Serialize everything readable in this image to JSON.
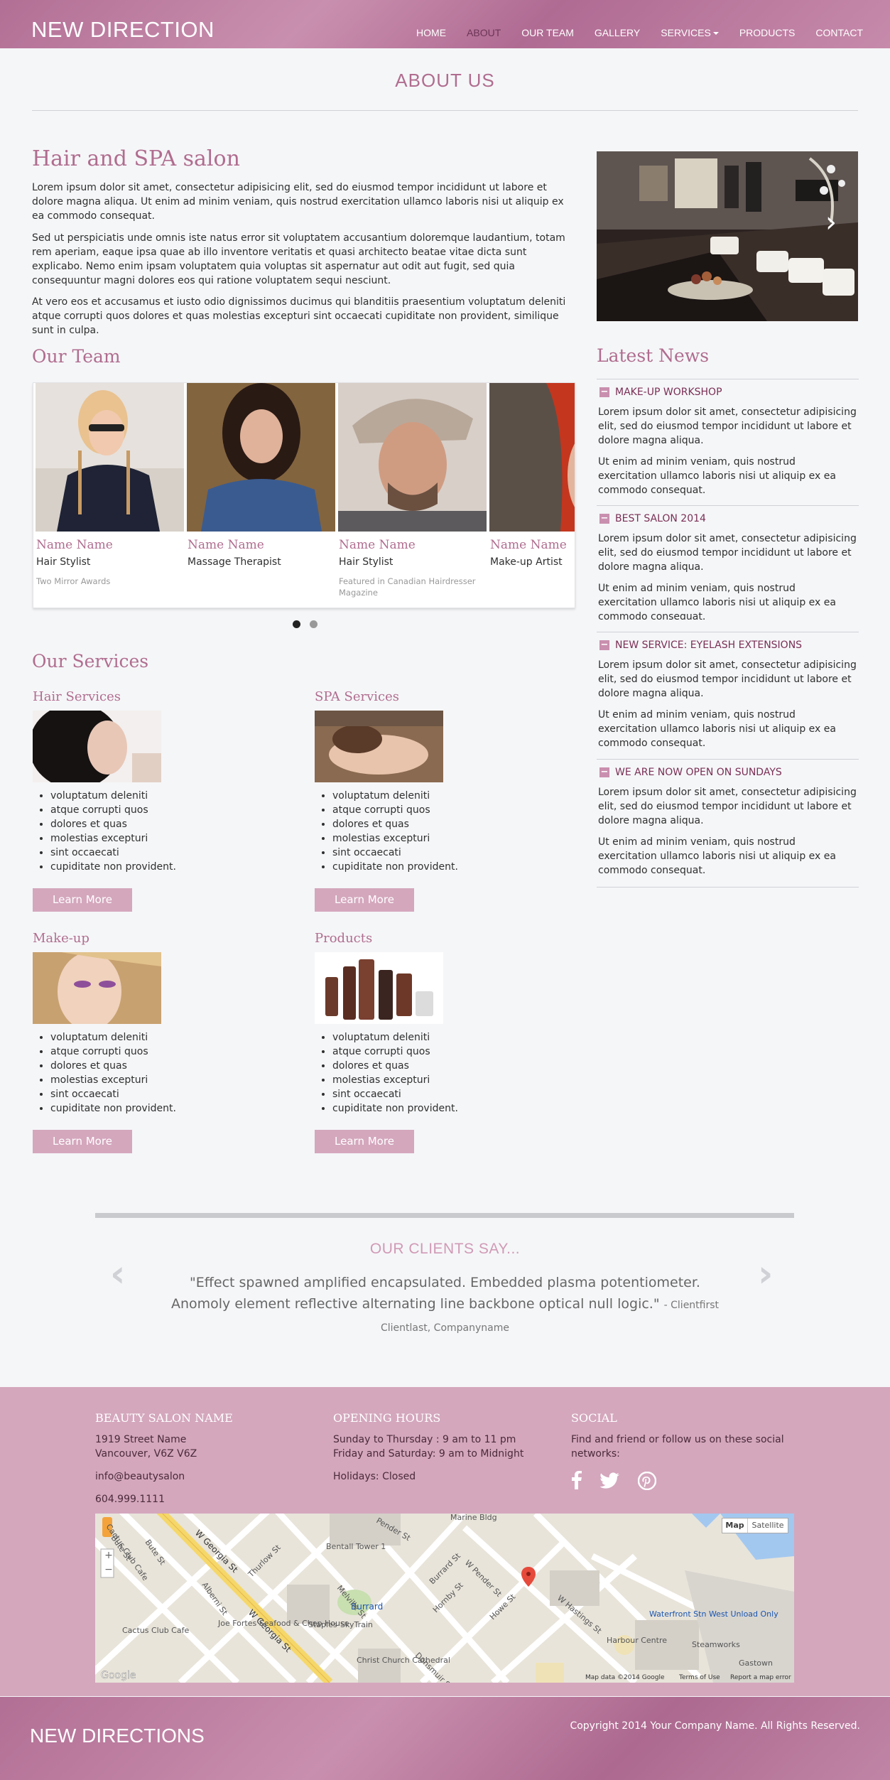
{
  "header": {
    "logo": "NEW DIRECTION",
    "nav": [
      "HOME",
      "ABOUT",
      "OUR TEAM",
      "GALLERY",
      "SERVICES",
      "PRODUCTS",
      "CONTACT"
    ],
    "active": "ABOUT"
  },
  "page_title": "ABOUT US",
  "about": {
    "heading": "Hair and SPA salon",
    "paragraphs": [
      "Lorem ipsum dolor sit amet, consectetur adipisicing elit, sed do eiusmod tempor incididunt ut labore et dolore magna aliqua. Ut enim ad minim veniam, quis nostrud exercitation ullamco laboris nisi ut aliquip ex ea commodo consequat.",
      "Sed ut perspiciatis unde omnis iste natus error sit voluptatem accusantium doloremque laudantium, totam rem aperiam, eaque ipsa quae ab illo inventore veritatis et quasi architecto beatae vitae dicta sunt explicabo. Nemo enim ipsam voluptatem quia voluptas sit aspernatur aut odit aut fugit, sed quia consequuntur magni dolores eos qui ratione voluptatem sequi nesciunt.",
      "At vero eos et accusamus et iusto odio dignissimos ducimus qui blanditiis praesentium voluptatum deleniti atque corrupti quos dolores et quas molestias excepturi sint occaecati cupiditate non provident, similique sunt in culpa."
    ]
  },
  "team": {
    "heading": "Our Team",
    "members": [
      {
        "name": "Name Name",
        "role": "Hair Stylist",
        "award": "Two Mirror Awards"
      },
      {
        "name": "Name Name",
        "role": "Massage Therapist",
        "award": ""
      },
      {
        "name": "Name Name",
        "role": "Hair Stylist",
        "award": "Featured in Canadian Hairdresser Magazine"
      },
      {
        "name": "Name Name",
        "role": "Make-up Artist",
        "award": ""
      }
    ]
  },
  "news": {
    "heading": "Latest News",
    "items": [
      {
        "title": "MAKE-UP WORKSHOP",
        "p1": "Lorem ipsum dolor sit amet, consectetur adipisicing elit, sed do eiusmod tempor incididunt ut labore et dolore magna aliqua.",
        "p2": "Ut enim ad minim veniam, quis nostrud exercitation ullamco laboris nisi ut aliquip ex ea commodo consequat."
      },
      {
        "title": "BEST SALON 2014",
        "p1": "Lorem ipsum dolor sit amet, consectetur adipisicing elit, sed do eiusmod tempor incididunt ut labore et dolore magna aliqua.",
        "p2": "Ut enim ad minim veniam, quis nostrud exercitation ullamco laboris nisi ut aliquip ex ea commodo consequat."
      },
      {
        "title": "NEW SERVICE: EYELASH EXTENSIONS",
        "p1": "Lorem ipsum dolor sit amet, consectetur adipisicing elit, sed do eiusmod tempor incididunt ut labore et dolore magna aliqua.",
        "p2": "Ut enim ad minim veniam, quis nostrud exercitation ullamco laboris nisi ut aliquip ex ea commodo consequat."
      },
      {
        "title": "WE ARE NOW OPEN ON SUNDAYS",
        "p1": "Lorem ipsum dolor sit amet, consectetur adipisicing elit, sed do eiusmod tempor incididunt ut labore et dolore magna aliqua.",
        "p2": "Ut enim ad minim veniam, quis nostrud exercitation ullamco laboris nisi ut aliquip ex ea commodo consequat."
      }
    ]
  },
  "services": {
    "heading": "Our Services",
    "items": [
      {
        "title": "Hair Services",
        "bullets": [
          "voluptatum deleniti",
          "atque corrupti quos",
          "dolores et quas",
          "molestias excepturi",
          "sint occaecati",
          "cupiditate non provident."
        ],
        "button": "Learn More"
      },
      {
        "title": "SPA Services",
        "bullets": [
          "voluptatum deleniti",
          "atque corrupti quos",
          "dolores et quas",
          "molestias excepturi",
          "sint occaecati",
          "cupiditate non provident."
        ],
        "button": "Learn More"
      },
      {
        "title": "Make-up",
        "bullets": [
          "voluptatum deleniti",
          "atque corrupti quos",
          "dolores et quas",
          "molestias excepturi",
          "sint occaecati",
          "cupiditate non provident."
        ],
        "button": "Learn More"
      },
      {
        "title": "Products",
        "bullets": [
          "voluptatum deleniti",
          "atque corrupti quos",
          "dolores et quas",
          "molestias excepturi",
          "sint occaecati",
          "cupiditate non provident."
        ],
        "button": "Learn More"
      }
    ]
  },
  "testimonial": {
    "heading": "OUR CLIENTS SAY...",
    "quote": "\"Effect spawned amplified encapsulated. Embedded plasma potentiometer. Anomoly element reflective alternating line backbone optical null logic.\"",
    "author": "- Clientfirst Clientlast, Companyname"
  },
  "footer": {
    "col1": {
      "heading": "BEAUTY SALON NAME",
      "address1": "1919 Street Name",
      "address2": "Vancouver, V6Z V6Z",
      "email": "info@beautysalon",
      "phone": "604.999.1111"
    },
    "col2": {
      "heading": "OPENING HOURS",
      "line1": "Sunday to Thursday : 9 am to 11 pm",
      "line2": "Friday and Saturday: 9 am to Midnight",
      "line3": "Holidays: Closed"
    },
    "col3": {
      "heading": "SOCIAL",
      "text": "Find and friend or follow us on these social networks:",
      "icons": [
        "facebook-icon",
        "twitter-icon",
        "pinterest-icon"
      ]
    }
  },
  "map": {
    "btn_map": "Map",
    "btn_sat": "Satellite",
    "labels": [
      "Pender St",
      "Marine Bldg",
      "Bentall Tower 1",
      "W Georgia St",
      "W Georgia St",
      "Thurlow St",
      "Burrard St",
      "Burrard",
      "W Pender St",
      "Alberni St",
      "Bute St",
      "Joe Fortes Seafood & Chop House",
      "Staples",
      "SkyTrain",
      "Hornby St",
      "Howe St",
      "Cactus Club Cafe",
      "Christ Church Cathedral",
      "Dunsmuir St",
      "W Hastings St",
      "Waterfront Stn West Unload Only",
      "Harbour Centre",
      "Steamworks",
      "Gastown",
      "Melville St",
      "Google",
      "Map data ©2014 Google",
      "Terms of Use",
      "Report a map error",
      "Howe St",
      "Hornby St"
    ]
  },
  "bottom": {
    "logo": "NEW DIRECTIONS",
    "copyright": "Copyright 2014 Your Company Name. All Rights Reserved."
  },
  "colors": {
    "brand": "#b06d8f",
    "button": "#d4a7bd",
    "footer": "#d4a7bd"
  }
}
